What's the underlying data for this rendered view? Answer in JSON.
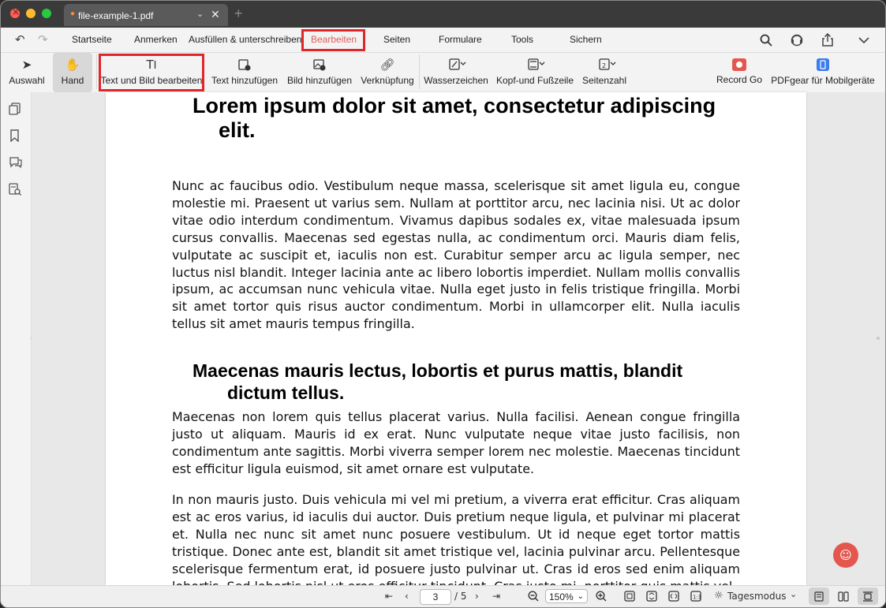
{
  "tab": {
    "name": "file-example-1.pdf",
    "chevron": "⌄",
    "close": "✕",
    "new_tab": "+"
  },
  "menu": {
    "items": [
      "Startseite",
      "Anmerken",
      "Ausfüllen & unterschreiben",
      "Bearbeiten",
      "Seiten",
      "Formulare",
      "Tools",
      "Sichern"
    ],
    "active": "Bearbeiten",
    "icons": [
      "undo-icon",
      "redo-icon",
      "search-icon",
      "support-icon",
      "share-icon",
      "chevron-down-icon"
    ]
  },
  "toolbar": {
    "auswahl": "Auswahl",
    "hand": "Hand",
    "text_bild": "Text und Bild bearbeiten",
    "text_hinzu": "Text hinzufügen",
    "bild_hinzu": "Bild hinzufügen",
    "verknuepfung": "Verknüpfung",
    "wasserzeichen": "Wasserzeichen",
    "kopf_fuss": "Kopf-und Fußzeile",
    "seitenzahl": "Seitenzahl",
    "record_go": "Record Go",
    "pdfgear": "PDFgear für Mobilgeräte"
  },
  "document": {
    "title_line1": "Lorem ipsum dolor sit amet, consectetur adipiscing",
    "title_line2": "elit.",
    "para1": "Nunc ac faucibus odio. Vestibulum neque massa, scelerisque sit amet ligula eu, congue molestie mi. Praesent ut varius sem. Nullam at porttitor arcu, nec lacinia nisi. Ut ac dolor vitae odio interdum condimentum. Vivamus dapibus sodales ex, vitae malesuada ipsum cursus convallis. Maecenas sed egestas nulla, ac condimentum orci. Mauris diam felis, vulputate ac suscipit et, iaculis non est. Curabitur semper arcu ac ligula semper, nec luctus nisl blandit. Integer lacinia ante ac libero lobortis imperdiet. Nullam mollis convallis ipsum, ac accumsan nunc vehicula vitae. Nulla eget justo in felis tristique fringilla. Morbi sit amet tortor quis risus auctor condimentum. Morbi in ullamcorper elit. Nulla iaculis tellus sit amet mauris tempus fringilla.",
    "heading2_line1": "Maecenas mauris lectus, lobortis et purus mattis, blandit",
    "heading2_line2": "dictum tellus.",
    "para2": "Maecenas non lorem quis tellus placerat varius. Nulla facilisi. Aenean congue fringilla justo ut aliquam. Mauris id ex erat. Nunc vulputate neque vitae justo facilisis, non condimentum ante sagittis. Morbi viverra semper lorem nec molestie. Maecenas tincidunt est efficitur ligula euismod, sit amet ornare est vulputate.",
    "para3": "In non mauris justo. Duis vehicula mi vel mi pretium, a viverra erat efficitur. Cras aliquam est ac eros varius, id iaculis dui auctor. Duis pretium neque ligula, et pulvinar mi placerat et. Nulla nec nunc sit amet nunc posuere vestibulum. Ut id neque eget tortor mattis tristique. Donec ante est, blandit sit amet tristique vel, lacinia pulvinar arcu. Pellentesque scelerisque fermentum erat, id posuere justo pulvinar ut. Cras id eros sed enim aliquam lobortis. Sed lobortis nisl ut eros efficitur tincidunt. Cras justo mi, porttitor quis mattis vel,"
  },
  "status": {
    "current_page": "3",
    "total_pages": "/ 5",
    "zoom": "150%",
    "day_mode": "Tagesmodus"
  },
  "colors": {
    "highlight_box": "#e0262b",
    "active_menu": "#e35b5b",
    "assistant": "#e4574f"
  }
}
